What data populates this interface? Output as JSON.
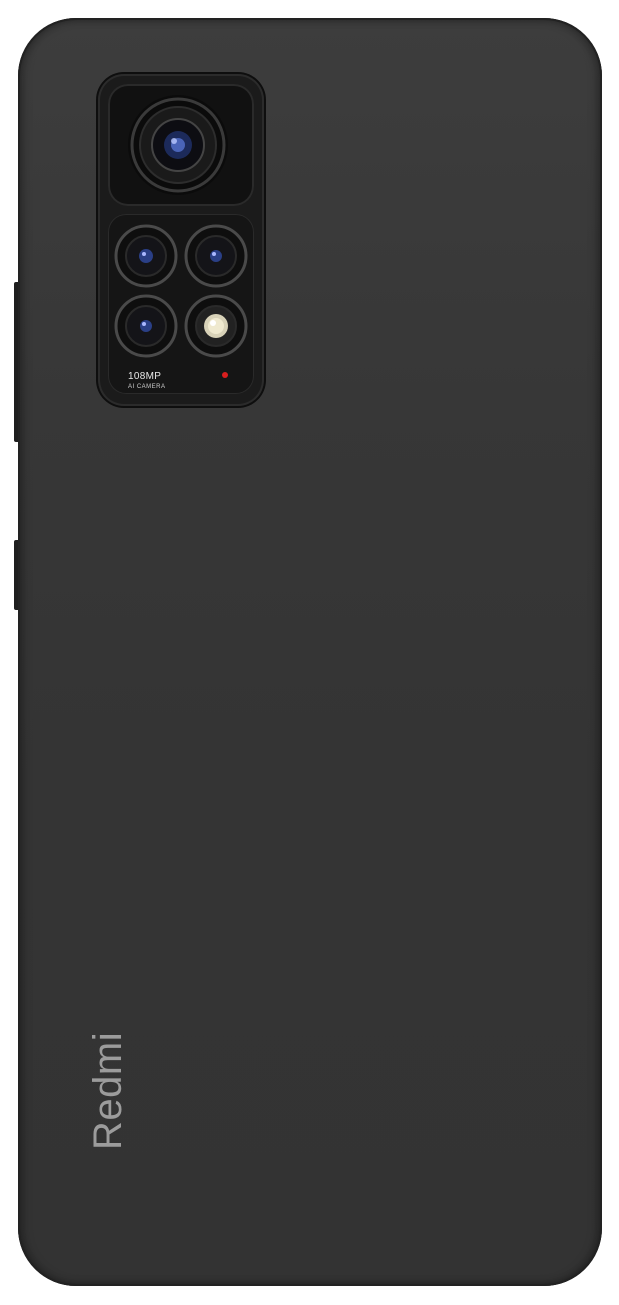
{
  "camera": {
    "spec_label": "108MP",
    "spec_sublabel": "AI CAMERA"
  },
  "brand": {
    "logo_text": "Redmi"
  },
  "colors": {
    "body": "#383838",
    "flash_indicator": "#d81e1e",
    "logo": "#9c9c9c"
  }
}
